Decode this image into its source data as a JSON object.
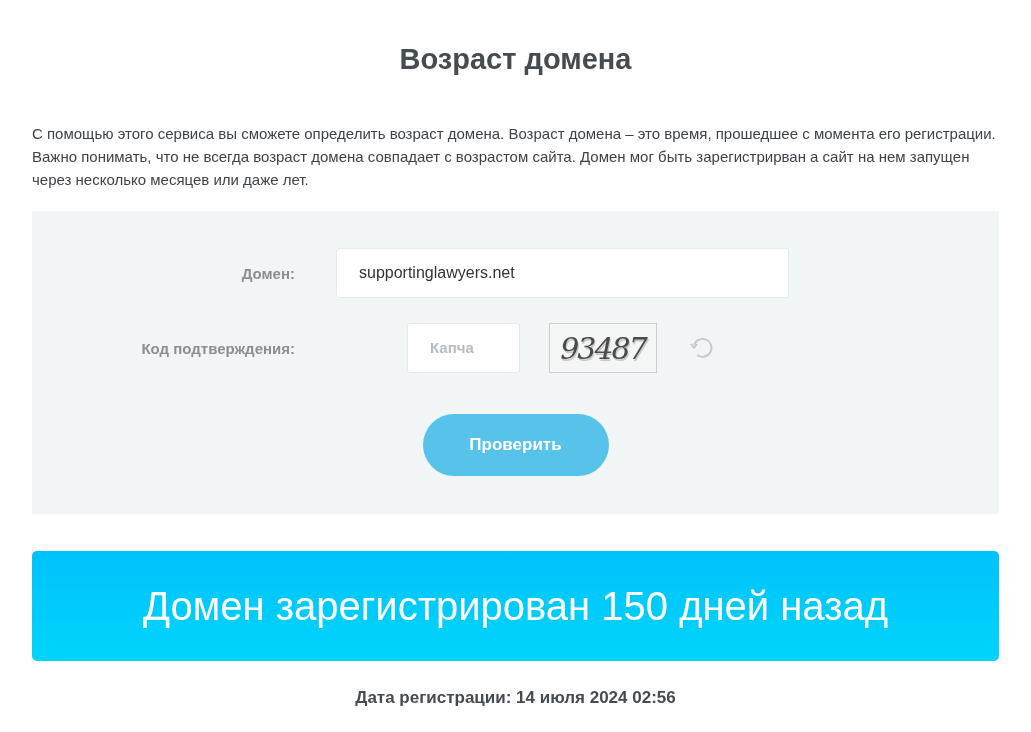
{
  "title": "Возраст домена",
  "description": "С помощью этого сервиса вы сможете определить возраст домена. Возраст домена – это время, прошедшее с момента его регистрации. Важно понимать, что не всегда возраст домена совпадает с возрастом сайта. Домен мог быть зарегистрирван а сайт на нем запущен через несколько месяцев или даже лет.",
  "form": {
    "domain_label": "Домен:",
    "domain_value": "supportinglawyers.net",
    "captcha_label": "Код подтверждения:",
    "captcha_placeholder": "Капча",
    "captcha_text": "93487",
    "submit": "Проверить"
  },
  "result": "Домен зарегистрирован 150 дней назад",
  "registration_date": "Дата регистрации: 14 июля 2024 02:56"
}
